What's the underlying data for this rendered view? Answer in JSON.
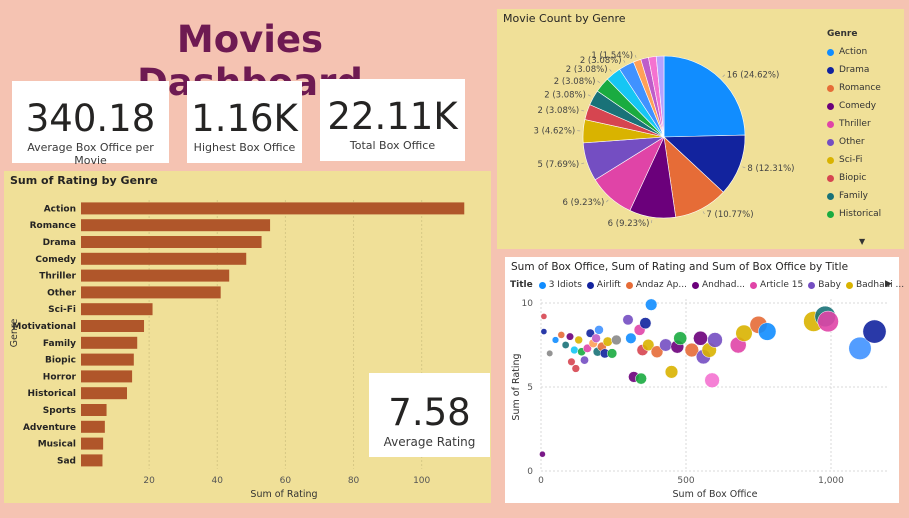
{
  "header": {
    "title": "Movies Dashboard"
  },
  "kpis": {
    "avg_box_office": {
      "value": "340.18",
      "label": "Average Box Office per Movie"
    },
    "highest_box_office": {
      "value": "1.16K",
      "label": "Highest Box Office"
    },
    "total_box_office": {
      "value": "22.11K",
      "label": "Total Box Office"
    },
    "avg_rating": {
      "value": "7.58",
      "label": "Average Rating"
    }
  },
  "bar_panel": {
    "title": "Sum of Rating by Genre"
  },
  "pie_panel": {
    "title": "Movie Count by Genre",
    "legend_title": "Genre"
  },
  "scatter_panel": {
    "title": "Sum of Box Office, Sum of Rating and Sum of Box Office by Title",
    "legend_title": "Title"
  },
  "colors": {
    "bar": "#b0562a",
    "panel_bg": "#f0e098",
    "page_bg": "#f5c3b2",
    "title": "#6e1a52"
  },
  "chart_data": [
    {
      "type": "bar",
      "orientation": "horizontal",
      "title": "Sum of Rating by Genre",
      "xlabel": "Sum of Rating",
      "ylabel": "Genre",
      "xlim": [
        0,
        118
      ],
      "x_ticks": [
        "20",
        "40",
        "60",
        "80",
        "100"
      ],
      "categories": [
        "Action",
        "Romance",
        "Drama",
        "Comedy",
        "Thriller",
        "Other",
        "Sci-Fi",
        "Motivational",
        "Family",
        "Biopic",
        "Horror",
        "Historical",
        "Sports",
        "Adventure",
        "Musical",
        "Sad"
      ],
      "values": [
        112.5,
        55.5,
        53,
        48.5,
        43.5,
        41,
        21,
        18.5,
        16.5,
        15.5,
        15,
        13.5,
        7.5,
        7,
        6.5,
        6.3
      ],
      "grid": true
    },
    {
      "type": "pie",
      "title": "Movie Count by Genre",
      "legend_position": "right",
      "labels": [
        "Action",
        "Drama",
        "Romance",
        "Comedy",
        "Thriller",
        "Other",
        "Sci-Fi",
        "Biopic",
        "Family",
        "Historical",
        "Horror",
        "Motivational",
        "Sports",
        "Adventure",
        "Musical",
        "Sad"
      ],
      "values": [
        16,
        8,
        7,
        6,
        6,
        5,
        3,
        2,
        2,
        2,
        2,
        2,
        1,
        1,
        1,
        1
      ],
      "data_labels": [
        "16 (24.62%)",
        "8 (12.31%)",
        "7 (10.77%)",
        "6 (9.23%)",
        "6 (9.23%)",
        "5 (7.69%)",
        "3 (4.62%)",
        "2 (3.08%)",
        "2 (3.08%)",
        "2 (3.08%)",
        "2 (3.08%)",
        "2 (3.08%)",
        "1 (1.54%)",
        "",
        "",
        ""
      ],
      "colors": [
        "#118dff",
        "#12239e",
        "#e66c37",
        "#6b007b",
        "#e044a7",
        "#744ec2",
        "#d9b300",
        "#d64550",
        "#197278",
        "#1aab40",
        "#15c6f4",
        "#4092ff",
        "#ffa058",
        "#be5dc9",
        "#f472d0",
        "#b5a1ff"
      ],
      "legend_visible": [
        "Action",
        "Drama",
        "Romance",
        "Comedy",
        "Thriller",
        "Other",
        "Sci-Fi",
        "Biopic",
        "Family",
        "Historical"
      ]
    },
    {
      "type": "scatter",
      "title": "Sum of Box Office, Sum of Rating and Sum of Box Office by Title",
      "xlabel": "Sum of Box Office",
      "ylabel": "Sum of Rating",
      "xlim": [
        0,
        1200
      ],
      "ylim": [
        0,
        10
      ],
      "x_ticks": [
        "0",
        "500",
        "1,000"
      ],
      "y_ticks": [
        "0",
        "5",
        "10"
      ],
      "legend_series": [
        "3 Idiots",
        "Airlift",
        "Andaz Ap...",
        "Andhad...",
        "Article 15",
        "Baby",
        "Badhaai ..."
      ],
      "legend_colors": [
        "#118dff",
        "#12239e",
        "#e66c37",
        "#6b007b",
        "#e044a7",
        "#744ec2",
        "#d9b300"
      ],
      "points": [
        {
          "x": 10,
          "y": 9.2,
          "c": "#d64550"
        },
        {
          "x": 10,
          "y": 8.3,
          "c": "#12239e"
        },
        {
          "x": 30,
          "y": 7,
          "c": "#888888"
        },
        {
          "x": 50,
          "y": 7.8,
          "c": "#118dff"
        },
        {
          "x": 70,
          "y": 8.1,
          "c": "#e66c37"
        },
        {
          "x": 85,
          "y": 7.5,
          "c": "#197278"
        },
        {
          "x": 100,
          "y": 8,
          "c": "#6b007b"
        },
        {
          "x": 105,
          "y": 6.5,
          "c": "#d64550"
        },
        {
          "x": 115,
          "y": 7.2,
          "c": "#15c6f4"
        },
        {
          "x": 120,
          "y": 6.1,
          "c": "#d64550"
        },
        {
          "x": 130,
          "y": 7.8,
          "c": "#d9b300"
        },
        {
          "x": 140,
          "y": 7.1,
          "c": "#1aab40"
        },
        {
          "x": 150,
          "y": 6.6,
          "c": "#744ec2"
        },
        {
          "x": 160,
          "y": 7.3,
          "c": "#e044a7"
        },
        {
          "x": 170,
          "y": 8.2,
          "c": "#12239e"
        },
        {
          "x": 180,
          "y": 7.6,
          "c": "#ffa058"
        },
        {
          "x": 190,
          "y": 7.9,
          "c": "#be5dc9"
        },
        {
          "x": 195,
          "y": 7.1,
          "c": "#197278"
        },
        {
          "x": 200,
          "y": 8.4,
          "c": "#4092ff"
        },
        {
          "x": 210,
          "y": 7.4,
          "c": "#e66c37"
        },
        {
          "x": 220,
          "y": 7,
          "c": "#12239e"
        },
        {
          "x": 230,
          "y": 7.7,
          "c": "#d9b300"
        },
        {
          "x": 245,
          "y": 7,
          "c": "#1aab40"
        },
        {
          "x": 260,
          "y": 7.8,
          "c": "#888888"
        },
        {
          "x": 300,
          "y": 9,
          "c": "#744ec2"
        },
        {
          "x": 310,
          "y": 7.9,
          "c": "#118dff"
        },
        {
          "x": 320,
          "y": 5.6,
          "c": "#6b007b"
        },
        {
          "x": 340,
          "y": 8.4,
          "c": "#e044a7"
        },
        {
          "x": 345,
          "y": 5.5,
          "c": "#1aab40"
        },
        {
          "x": 350,
          "y": 7.2,
          "c": "#d64550"
        },
        {
          "x": 360,
          "y": 8.8,
          "c": "#12239e"
        },
        {
          "x": 370,
          "y": 7.5,
          "c": "#d9b300"
        },
        {
          "x": 380,
          "y": 9.9,
          "c": "#118dff"
        },
        {
          "x": 400,
          "y": 7.1,
          "c": "#e66c37"
        },
        {
          "x": 430,
          "y": 7.5,
          "c": "#744ec2"
        },
        {
          "x": 450,
          "y": 5.9,
          "c": "#d9b300"
        },
        {
          "x": 470,
          "y": 7.4,
          "c": "#6b007b"
        },
        {
          "x": 480,
          "y": 7.9,
          "c": "#1aab40"
        },
        {
          "x": 520,
          "y": 7.2,
          "c": "#e66c37"
        },
        {
          "x": 550,
          "y": 7.9,
          "c": "#6b007b"
        },
        {
          "x": 560,
          "y": 6.8,
          "c": "#744ec2"
        },
        {
          "x": 580,
          "y": 7.2,
          "c": "#d9b300"
        },
        {
          "x": 590,
          "y": 5.4,
          "c": "#f472d0"
        },
        {
          "x": 600,
          "y": 7.8,
          "c": "#744ec2"
        },
        {
          "x": 680,
          "y": 7.5,
          "c": "#e044a7"
        },
        {
          "x": 700,
          "y": 8.2,
          "c": "#d9b300"
        },
        {
          "x": 750,
          "y": 8.7,
          "c": "#e66c37"
        },
        {
          "x": 780,
          "y": 8.3,
          "c": "#118dff"
        },
        {
          "x": 940,
          "y": 8.9,
          "c": "#d9b300"
        },
        {
          "x": 980,
          "y": 9.2,
          "c": "#197278"
        },
        {
          "x": 990,
          "y": 8.9,
          "c": "#e044a7"
        },
        {
          "x": 1100,
          "y": 7.3,
          "c": "#4092ff"
        },
        {
          "x": 1150,
          "y": 8.3,
          "c": "#12239e"
        },
        {
          "x": 5,
          "y": 1,
          "c": "#6b007b"
        }
      ]
    }
  ]
}
